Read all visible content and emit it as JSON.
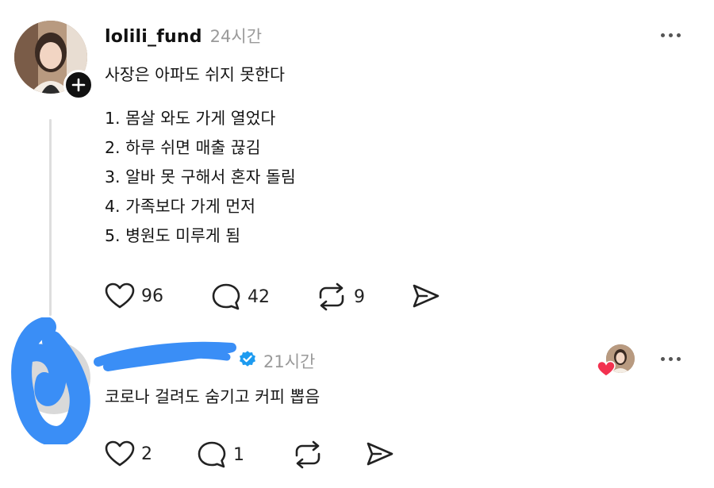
{
  "post": {
    "username": "lolili_fund",
    "time": "24시간",
    "title": "사장은 아파도 쉬지 못한다",
    "lines": [
      "1. 몸살 와도 가게 열었다",
      "2. 하루 쉬면 매출 끊김",
      "3. 알바 못 구해서 혼자 돌림",
      "4. 가족보다 가게 먼저",
      "5. 병원도 미루게 됨"
    ],
    "likes": "96",
    "comments": "42",
    "reposts": "9"
  },
  "reply": {
    "time": "21시간",
    "text": "코로나 걸려도 숨기고 커피 뽑음",
    "likes": "2",
    "comments": "1"
  },
  "colors": {
    "verified": "#1d9bf0",
    "scribble": "#3a8ef6",
    "heart": "#f2314f",
    "muted": "#9a9a9a"
  },
  "icons": [
    "plus-icon",
    "more-icon",
    "heart-icon",
    "comment-icon",
    "repost-icon",
    "share-icon",
    "verified-icon"
  ]
}
